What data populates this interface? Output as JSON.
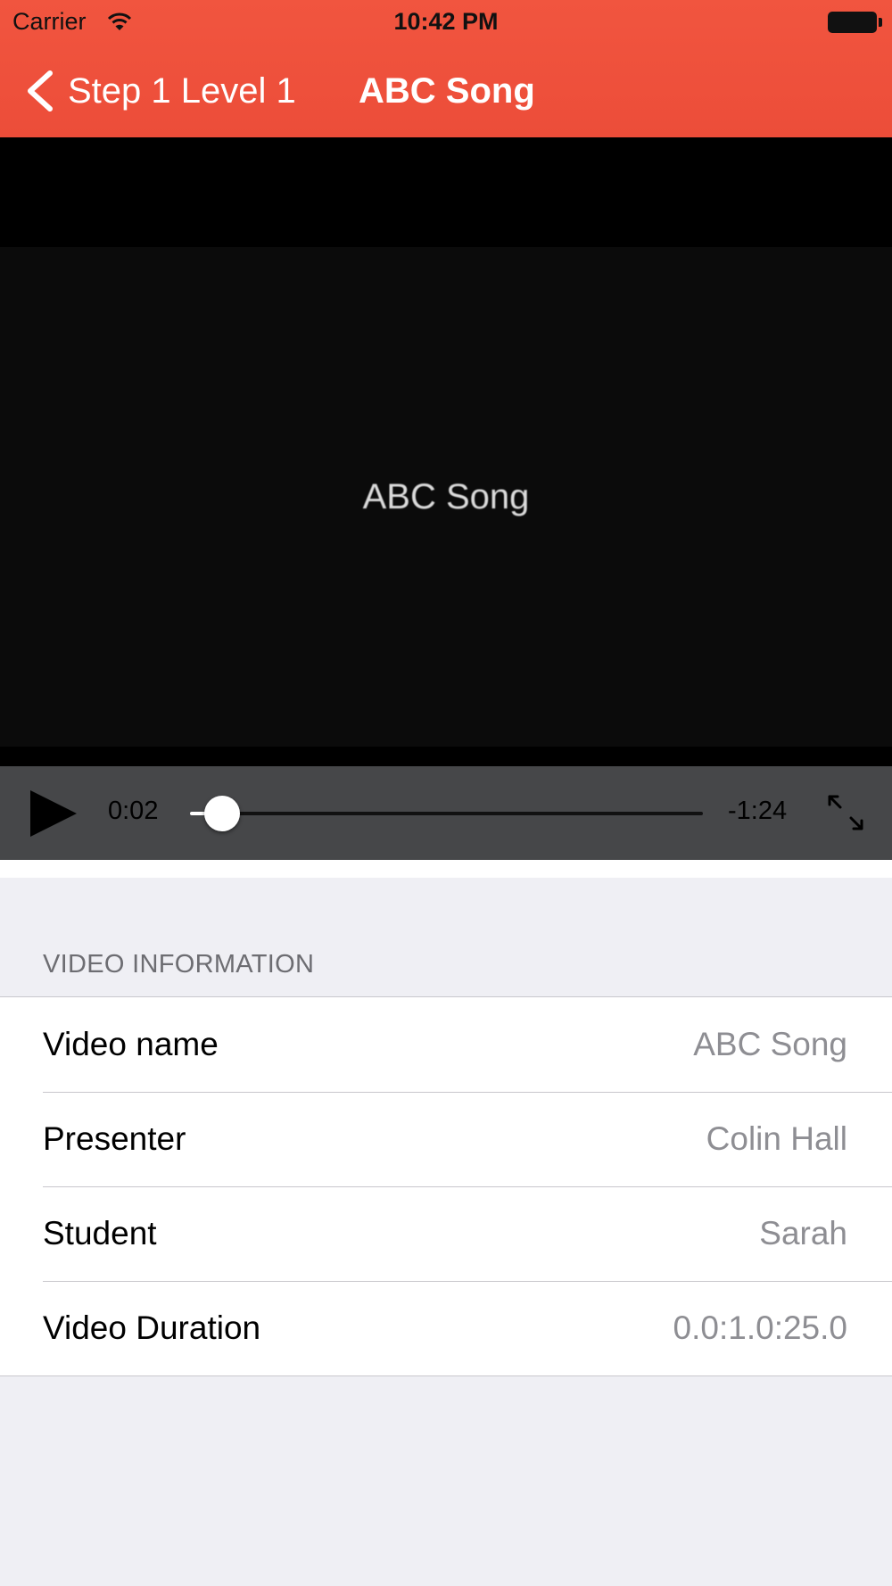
{
  "status_bar": {
    "carrier": "Carrier",
    "time": "10:42 PM"
  },
  "nav": {
    "back_label": "Step 1 Level 1",
    "title": "ABC Song"
  },
  "video": {
    "caption": "ABC Song",
    "current_time": "0:02",
    "remaining_time": "-1:24",
    "progress": 0.02,
    "state": "paused"
  },
  "info": {
    "section_title": "VIDEO INFORMATION",
    "rows": [
      {
        "label": "Video name",
        "value": "ABC Song"
      },
      {
        "label": "Presenter",
        "value": "Colin Hall"
      },
      {
        "label": "Student",
        "value": "Sarah"
      },
      {
        "label": "Video Duration",
        "value": "0.0:1.0:25.0"
      }
    ]
  },
  "colors": {
    "nav_bar": "#ec4d39",
    "controls_bg": "#464749",
    "page_bg": "#efeff4",
    "value_text": "#8e8e93"
  }
}
